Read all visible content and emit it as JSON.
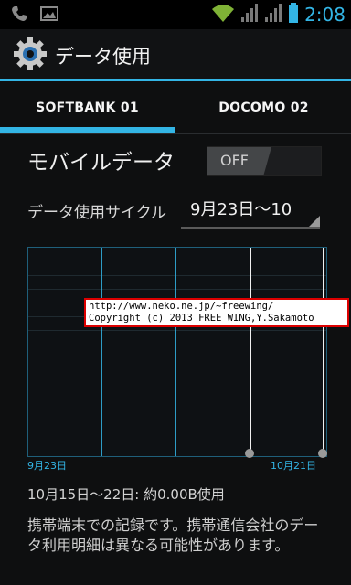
{
  "status_bar": {
    "time": "2:08",
    "icons": [
      "phone-icon",
      "image-icon",
      "wifi-icon",
      "signal-icon",
      "signal-icon",
      "battery-icon"
    ]
  },
  "action_bar": {
    "title": "データ使用",
    "icon": "settings-gear-icon"
  },
  "tabs": [
    {
      "label": "SOFTBANK 01",
      "selected": true
    },
    {
      "label": "DOCOMO 02",
      "selected": false
    }
  ],
  "mobile_data": {
    "label": "モバイルデータ",
    "toggle_state": "OFF"
  },
  "cycle": {
    "label": "データ使用サイクル",
    "value": "9月23日～10"
  },
  "chart": {
    "start_label": "9月23日",
    "end_label": "10月21日"
  },
  "watermark": {
    "line1": "http://www.neko.ne.jp/~freewing/",
    "line2": "Copyright (c) 2013 FREE WING,Y.Sakamoto"
  },
  "usage_summary": "10月15日～22日: 約0.00B使用",
  "note": "携帯端末での記録です。携帯通信会社のデータ利用明細は異なる可能性があります。",
  "colors": {
    "accent": "#33b5e5",
    "background": "#0e0f10"
  }
}
